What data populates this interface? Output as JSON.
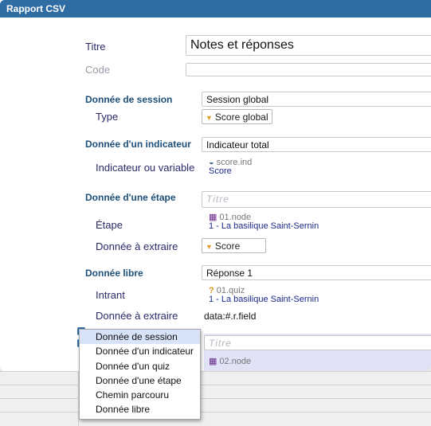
{
  "window": {
    "title": "Rapport CSV"
  },
  "titre": {
    "label": "Titre",
    "value": "Notes et réponses"
  },
  "code": {
    "label": "Code",
    "value": ""
  },
  "session": {
    "section": "Donnée de session",
    "value": "Session global",
    "type_label": "Type",
    "type_value": "Score global"
  },
  "indicateur": {
    "section": "Donnée d'un indicateur",
    "value": "Indicateur total",
    "var_label": "Indicateur ou variable",
    "ref_name": "score.ind",
    "ref_title": "Score"
  },
  "etape": {
    "section": "Donnée d'une étape",
    "placeholder": "Titre",
    "step_label": "Étape",
    "ref_name": "01.node",
    "ref_title": "1 - La basilique Saint-Sernin",
    "extract_label": "Donnée à extraire",
    "extract_value": "Score"
  },
  "libre": {
    "section": "Donnée libre",
    "value": "Réponse 1",
    "intrant_label": "Intrant",
    "ref_name": "01.quiz",
    "ref_title": "1 - La basilique Saint-Sernin",
    "extract_label": "Donnée à extraire",
    "extract_value": "data:#.r.field"
  },
  "next": {
    "placeholder": "Titre",
    "ref_name": "02.node"
  },
  "menu": {
    "items": [
      "Donnée de session",
      "Donnée d'un indicateur",
      "Donnée d'un quiz",
      "Donnée d'une étape",
      "Chemin parcouru",
      "Donnée libre"
    ]
  },
  "colors": {
    "titlebar": "#2e6da4",
    "section": "#1d4f7a",
    "caret": "#e39b2a",
    "menu_highlight": "#d6e3f8"
  }
}
